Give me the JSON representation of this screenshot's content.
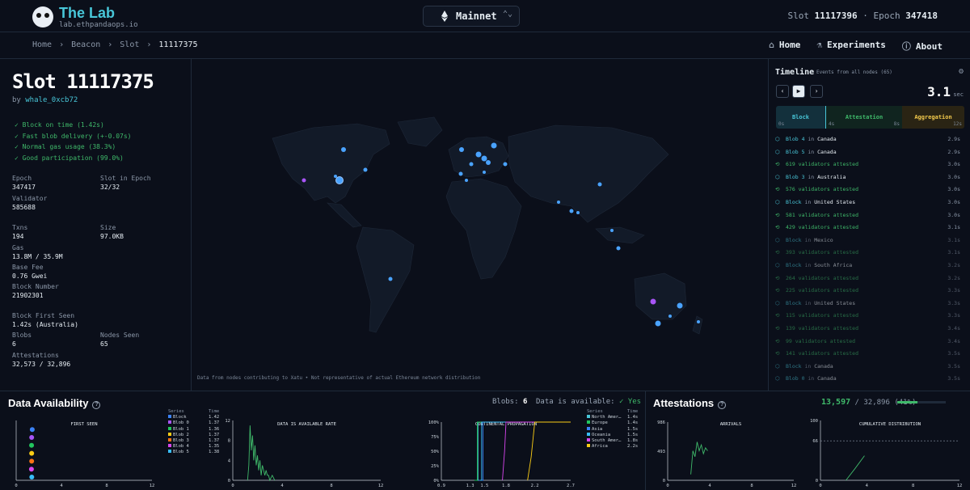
{
  "header": {
    "brand": "The Lab",
    "brand_sub": "lab.ethpandaops.io",
    "network": "Mainnet",
    "slot_label": "Slot",
    "slot_value": "11117396",
    "epoch_label": "Epoch",
    "epoch_value": "347418"
  },
  "breadcrumbs": [
    "Home",
    "Beacon",
    "Slot",
    "11117375"
  ],
  "nav": [
    {
      "label": "Home",
      "icon": "home-icon"
    },
    {
      "label": "Experiments",
      "icon": "flask-icon"
    },
    {
      "label": "About",
      "icon": "info-icon"
    }
  ],
  "slot": {
    "title": "Slot 11117375",
    "by_label": "by",
    "proposer": "whale_0xcb72",
    "checks": [
      "✓ Block on time (1.42s)",
      "✓ Fast blob delivery (+-0.07s)",
      "✓ Normal gas usage (38.3%)",
      "✓ Good participation (99.0%)"
    ],
    "fields": {
      "epoch": {
        "label": "Epoch",
        "value": "347417"
      },
      "slot_in_epoch": {
        "label": "Slot in Epoch",
        "value": "32/32"
      },
      "validator": {
        "label": "Validator",
        "value": "585688"
      },
      "txns": {
        "label": "Txns",
        "value": "194"
      },
      "size": {
        "label": "Size",
        "value": "97.0KB"
      },
      "gas": {
        "label": "Gas",
        "value": "13.8M / 35.9M"
      },
      "base_fee": {
        "label": "Base Fee",
        "value": "0.76 Gwei"
      },
      "block_number": {
        "label": "Block Number",
        "value": "21902301"
      },
      "first_seen": {
        "label": "Block First Seen",
        "value": "1.42s (Australia)"
      },
      "blobs": {
        "label": "Blobs",
        "value": "6"
      },
      "nodes_seen": {
        "label": "Nodes Seen",
        "value": "65"
      },
      "attestations": {
        "label": "Attestations",
        "value": "32,573 / 32,896"
      }
    }
  },
  "map": {
    "note": "Data from nodes contributing to Xatu • Not representative of actual Ethereum network distribution"
  },
  "timeline": {
    "title": "Timeline",
    "subtitle": "Events from all nodes (65)",
    "time": "3.1",
    "time_unit": "sec",
    "phases": [
      {
        "label": "Block",
        "start": "0s",
        "color": "#48c6d8"
      },
      {
        "label": "Attestation",
        "start": "4s",
        "end": "8s",
        "color": "#3fb96a"
      },
      {
        "label": "Aggregation",
        "end": "12s",
        "color": "#f2c94c"
      }
    ],
    "events": [
      {
        "kind": "blob",
        "pre": "Blob 4",
        "mid": " in ",
        "loc": "Canada",
        "t": "2.9s"
      },
      {
        "kind": "blob",
        "pre": "Blob 5",
        "mid": " in ",
        "loc": "Canada",
        "t": "2.9s"
      },
      {
        "kind": "att",
        "pre": "619 validators attested",
        "mid": "",
        "loc": "",
        "t": "3.0s"
      },
      {
        "kind": "blob",
        "pre": "Blob 3",
        "mid": " in ",
        "loc": "Australia",
        "t": "3.0s"
      },
      {
        "kind": "att",
        "pre": "576 validators attested",
        "mid": "",
        "loc": "",
        "t": "3.0s"
      },
      {
        "kind": "blob",
        "pre": "Block",
        "mid": " in ",
        "loc": "United States",
        "t": "3.0s"
      },
      {
        "kind": "att",
        "pre": "581 validators attested",
        "mid": "",
        "loc": "",
        "t": "3.0s"
      },
      {
        "kind": "att",
        "pre": "429 validators attested",
        "mid": "",
        "loc": "",
        "t": "3.1s"
      },
      {
        "kind": "blob",
        "pre": "Block",
        "mid": " in ",
        "loc": "Mexico",
        "t": "3.1s",
        "fade": true
      },
      {
        "kind": "att",
        "pre": "393 validators attested",
        "mid": "",
        "loc": "",
        "t": "3.1s",
        "fade": true
      },
      {
        "kind": "blob",
        "pre": "Block",
        "mid": " in ",
        "loc": "South Africa",
        "t": "3.2s",
        "fade": true
      },
      {
        "kind": "att",
        "pre": "264 validators attested",
        "mid": "",
        "loc": "",
        "t": "3.2s",
        "fade": true
      },
      {
        "kind": "att",
        "pre": "225 validators attested",
        "mid": "",
        "loc": "",
        "t": "3.3s",
        "fade": true
      },
      {
        "kind": "blob",
        "pre": "Block",
        "mid": " in ",
        "loc": "United States",
        "t": "3.3s",
        "fade": true
      },
      {
        "kind": "att",
        "pre": "115 validators attested",
        "mid": "",
        "loc": "",
        "t": "3.3s",
        "fade": true
      },
      {
        "kind": "att",
        "pre": "139 validators attested",
        "mid": "",
        "loc": "",
        "t": "3.4s",
        "fade": true
      },
      {
        "kind": "att",
        "pre": "99 validators attested",
        "mid": "",
        "loc": "",
        "t": "3.4s",
        "fade": true
      },
      {
        "kind": "att",
        "pre": "141 validators attested",
        "mid": "",
        "loc": "",
        "t": "3.5s",
        "fade": true
      },
      {
        "kind": "blob",
        "pre": "Block",
        "mid": " in ",
        "loc": "Canada",
        "t": "3.5s",
        "fade": true
      },
      {
        "kind": "blob",
        "pre": "Blob 0",
        "mid": " in ",
        "loc": "Canada",
        "t": "3.5s",
        "fade": true
      }
    ]
  },
  "data_availability": {
    "title": "Data Availability",
    "blobs_label": "Blobs:",
    "blobs_value": "6",
    "available_label": "Data is available:",
    "available_value": "Yes",
    "legend_series_header": "Series",
    "legend_time_header": "Time",
    "first_seen_legend": [
      {
        "name": "Block",
        "time": "1.42",
        "color": "#3b82f6"
      },
      {
        "name": "Blob 0",
        "time": "1.37",
        "color": "#a855f7"
      },
      {
        "name": "Blob 1",
        "time": "1.36",
        "color": "#22c55e"
      },
      {
        "name": "Blob 2",
        "time": "1.37",
        "color": "#facc15"
      },
      {
        "name": "Blob 3",
        "time": "1.37",
        "color": "#f97316"
      },
      {
        "name": "Blob 4",
        "time": "1.35",
        "color": "#d946ef"
      },
      {
        "name": "Blob 5",
        "time": "1.38",
        "color": "#38bdf8"
      }
    ],
    "continental_legend": [
      {
        "name": "North Amer…",
        "time": "1.4s",
        "color": "#48c6d8"
      },
      {
        "name": "Europe",
        "time": "1.4s",
        "color": "#22c55e"
      },
      {
        "name": "Asia",
        "time": "1.5s",
        "color": "#3b82f6"
      },
      {
        "name": "Oceania",
        "time": "1.5s",
        "color": "#38bdf8"
      },
      {
        "name": "South Amer…",
        "time": "1.8s",
        "color": "#d946ef"
      },
      {
        "name": "Africa",
        "time": "2.2s",
        "color": "#facc15"
      }
    ]
  },
  "attestations": {
    "title": "Attestations",
    "count": "13,597",
    "total": "/ 32,896",
    "pct": "(41%)",
    "fraction": 0.41
  },
  "chart_data": [
    {
      "type": "scatter",
      "title": "FIRST SEEN",
      "xlim": [
        0,
        12
      ],
      "x_ticks": [
        "0",
        "4",
        "8",
        "12"
      ],
      "series": [
        {
          "name": "Block",
          "x": [
            1.42
          ],
          "color": "#3b82f6"
        },
        {
          "name": "Blob 0",
          "x": [
            1.37
          ],
          "color": "#a855f7"
        },
        {
          "name": "Blob 1",
          "x": [
            1.36
          ],
          "color": "#22c55e"
        },
        {
          "name": "Blob 2",
          "x": [
            1.37
          ],
          "color": "#facc15"
        },
        {
          "name": "Blob 3",
          "x": [
            1.37
          ],
          "color": "#f97316"
        },
        {
          "name": "Blob 4",
          "x": [
            1.35
          ],
          "color": "#d946ef"
        },
        {
          "name": "Blob 5",
          "x": [
            1.38
          ],
          "color": "#38bdf8"
        }
      ]
    },
    {
      "type": "line",
      "title": "DATA IS AVAILABLE RATE",
      "xlim": [
        0,
        12
      ],
      "ylim": [
        0,
        12
      ],
      "x_ticks": [
        "0",
        "4",
        "8",
        "12"
      ],
      "y_ticks": [
        "0",
        "4",
        "8",
        "12"
      ],
      "x": [
        1.2,
        1.3,
        1.4,
        1.5,
        1.6,
        1.7,
        1.8,
        1.9,
        2.0,
        2.1,
        2.2,
        2.3,
        2.4,
        2.5,
        2.6,
        2.7,
        2.8,
        2.9,
        3.0,
        3.2,
        3.4
      ],
      "y": [
        0,
        3,
        11,
        6,
        9,
        4,
        7,
        3,
        5,
        2,
        4,
        1,
        3,
        2,
        1,
        2,
        1,
        1,
        0,
        1,
        0
      ],
      "color": "#3fb96a"
    },
    {
      "type": "line",
      "title": "CONTINENTAL PROPAGATION",
      "xlim": [
        0.9,
        2.7
      ],
      "ylim": [
        0,
        100
      ],
      "x_ticks": [
        "0.9",
        "1.3",
        "1.5",
        "1.8",
        "2.2",
        "2.7"
      ],
      "y_ticks": [
        "0%",
        "25%",
        "50%",
        "75%",
        "100%"
      ],
      "series": [
        {
          "name": "North Amer…",
          "x": [
            1.38,
            1.41,
            1.41,
            2.7
          ],
          "y": [
            0,
            0,
            100,
            100
          ],
          "color": "#48c6d8"
        },
        {
          "name": "Europe",
          "x": [
            1.36,
            1.4,
            1.4,
            2.7
          ],
          "y": [
            0,
            0,
            100,
            100
          ],
          "color": "#22c55e"
        },
        {
          "name": "Asia",
          "x": [
            1.42,
            1.48,
            1.48,
            2.7
          ],
          "y": [
            0,
            0,
            100,
            100
          ],
          "color": "#3b82f6"
        },
        {
          "name": "Oceania",
          "x": [
            1.44,
            1.46,
            1.46,
            2.7
          ],
          "y": [
            0,
            0,
            100,
            100
          ],
          "color": "#38bdf8"
        },
        {
          "name": "South Amer…",
          "x": [
            1.75,
            1.78,
            1.8,
            2.7
          ],
          "y": [
            0,
            50,
            100,
            100
          ],
          "color": "#d946ef"
        },
        {
          "name": "Africa",
          "x": [
            2.1,
            2.15,
            2.2,
            2.7
          ],
          "y": [
            0,
            40,
            100,
            100
          ],
          "color": "#facc15"
        }
      ]
    },
    {
      "type": "line",
      "title": "ARRIVALS",
      "xlim": [
        0,
        12
      ],
      "ylim": [
        0,
        986
      ],
      "x_ticks": [
        "0",
        "4",
        "8",
        "12"
      ],
      "y_ticks": [
        "0",
        "493",
        "986"
      ],
      "x": [
        2.2,
        2.4,
        2.6,
        2.8,
        3.0,
        3.2,
        3.4,
        3.6,
        3.8
      ],
      "y": [
        100,
        500,
        400,
        650,
        500,
        600,
        450,
        550,
        500
      ],
      "color": "#3fb96a"
    },
    {
      "type": "line",
      "title": "CUMULATIVE DISTRIBUTION",
      "xlim": [
        0,
        12
      ],
      "ylim": [
        0,
        100
      ],
      "x_ticks": [
        "0",
        "4",
        "8",
        "12"
      ],
      "y_ticks": [
        "0",
        "66",
        "100"
      ],
      "x": [
        2.2,
        3.0,
        3.8
      ],
      "y": [
        0,
        20,
        41
      ],
      "threshold": 66,
      "color": "#3fb96a"
    }
  ]
}
